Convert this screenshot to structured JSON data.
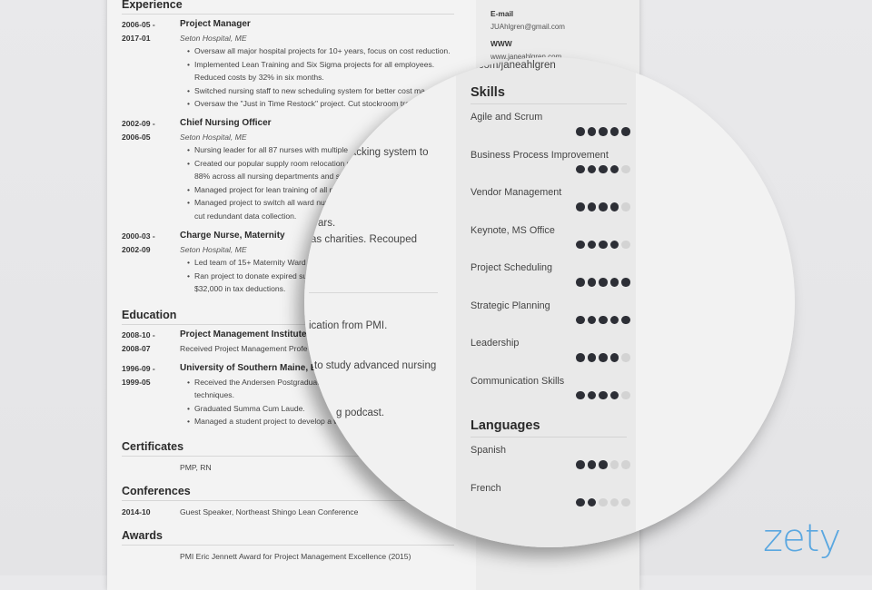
{
  "resume": {
    "sections": {
      "experience": "Experience",
      "education": "Education",
      "certificates": "Certificates",
      "conferences": "Conferences",
      "awards": "Awards"
    },
    "experience": [
      {
        "date_start": "2006-05 -",
        "date_end": "2017-01",
        "role": "Project Manager",
        "org": "Seton Hospital, ME",
        "bullets": [
          "Oversaw all major hospital projects for 10+ years, focus on cost reduction.",
          "Implemented Lean Training and Six Sigma projects for all employees.",
          "Reduced costs by 32% in six months.",
          "Switched nursing staff to new scheduling system for better cost ma",
          "Oversaw the \"Just in Time Restock\" project. Cut stockroom traffic by"
        ]
      },
      {
        "date_start": "2002-09 -",
        "date_end": "2006-05",
        "role": "Chief Nursing Officer",
        "org": "Seton Hospital, ME",
        "bullets": [
          "Nursing leader for all 87 nurses with multiple",
          "Created our popular supply room relocation p",
          "88% across all nursing departments and st",
          "Managed project for lean training of all n",
          "Managed project to switch all ward nur",
          "cut redundant data collection."
        ]
      },
      {
        "date_start": "2000-03 -",
        "date_end": "2002-09",
        "role": "Charge Nurse, Maternity",
        "org": "Seton Hospital, ME",
        "bullets": [
          "Led team of 15+ Maternity Ward n",
          "Ran project to donate expired sup",
          "$32,000 in tax deductions."
        ]
      }
    ],
    "education": [
      {
        "date_start": "2008-10 -",
        "date_end": "2008-07",
        "school": "Project Management Institute",
        "detail": "Received Project Management Profe"
      },
      {
        "date_start": "1996-09 -",
        "date_end": "1999-05",
        "school": "University of Southern Maine, E",
        "bullets": [
          "Received the Andersen Postgraduate",
          "techniques.",
          "Graduated Summa Cum Laude.",
          "Managed a student project to develop a w"
        ]
      }
    ],
    "certificates": {
      "text": "PMP, RN"
    },
    "conferences": {
      "date": "2014-10",
      "text": "Guest Speaker, Northeast Shingo Lean Conference"
    },
    "awards": {
      "text": "PMI Eric Jennett Award for Project Management Excellence (2015)"
    },
    "contact": {
      "email_label": "E-mail",
      "email": "JUAhlgren@gmail.com",
      "www_label": "WWW",
      "www": "www.janeahlgren.com"
    }
  },
  "magnifier": {
    "fragments": {
      "twitter": "itter.com/janeahlgren",
      "tracking": "racking system to",
      "years": "ars.",
      "charities": "as charities. Recouped",
      "pmi": "ication from PMI.",
      "nursing": "to study advanced nursing",
      "podcast": "g podcast."
    },
    "skills_title": "Skills",
    "skills": [
      {
        "name": "Agile and Scrum",
        "level": 5,
        "max": 5
      },
      {
        "name": "Business Process Improvement",
        "level": 4,
        "max": 5
      },
      {
        "name": "Vendor Management",
        "level": 4,
        "max": 5
      },
      {
        "name": "Keynote, MS Office",
        "level": 4,
        "max": 5
      },
      {
        "name": "Project Scheduling",
        "level": 5,
        "max": 5
      },
      {
        "name": "Strategic Planning",
        "level": 5,
        "max": 5
      },
      {
        "name": "Leadership",
        "level": 4,
        "max": 5
      },
      {
        "name": "Communication Skills",
        "level": 4,
        "max": 5
      }
    ],
    "languages_title": "Languages",
    "languages": [
      {
        "name": "Spanish",
        "level": 3,
        "max": 5
      },
      {
        "name": "French",
        "level": 2,
        "max": 5
      }
    ]
  },
  "brand": {
    "logo": "zety",
    "color": "#5aa7e0"
  },
  "colors": {
    "dot_on": "#2d2f36",
    "dot_off": "#d3d3d3"
  }
}
